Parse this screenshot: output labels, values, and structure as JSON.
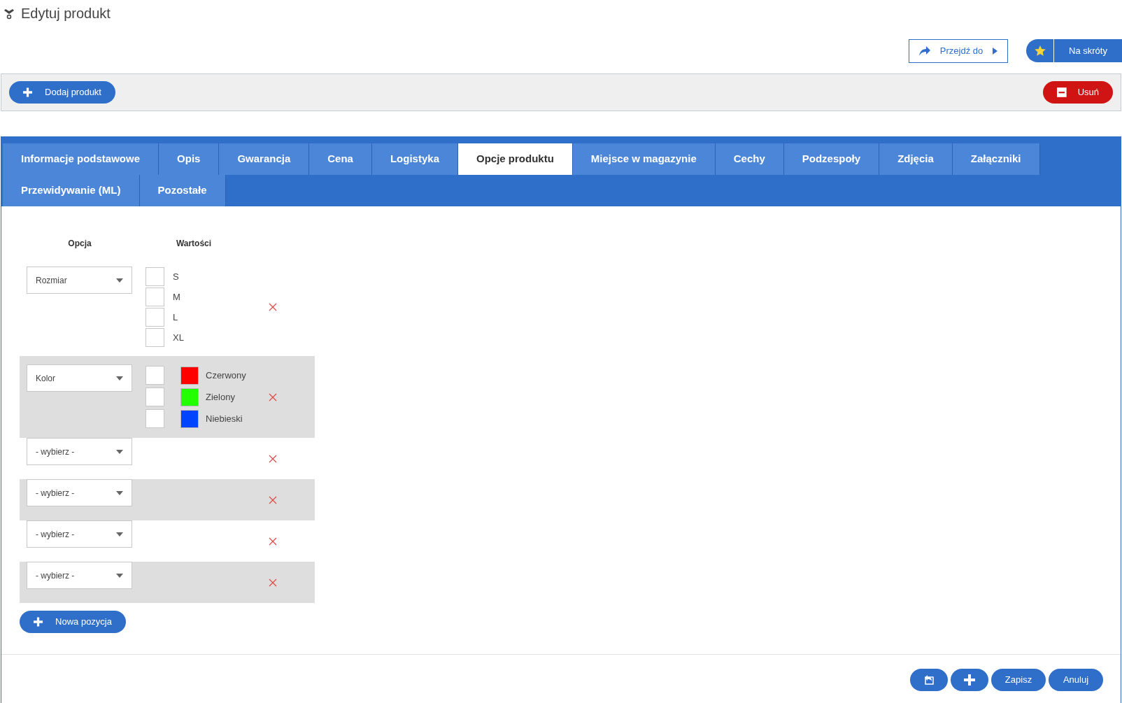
{
  "page_title": "Edytuj produkt",
  "header_buttons": [
    {
      "kind": "goto",
      "label": "Przejdź do"
    },
    {
      "kind": "shortcuts",
      "label": "Na skróty"
    }
  ],
  "toolbar": {
    "add_button": "Dodaj produkt",
    "delete_button": "Usuń"
  },
  "tabs": [
    {
      "label": "Informacje podstawowe",
      "selected": false
    },
    {
      "label": "Opis",
      "selected": false
    },
    {
      "label": "Gwarancja",
      "selected": false
    },
    {
      "label": "Cena",
      "selected": false
    },
    {
      "label": "Logistyka",
      "selected": false
    },
    {
      "label": "Opcje produktu",
      "selected": true
    },
    {
      "label": "Miejsce w magazynie",
      "selected": false
    },
    {
      "label": "Cechy",
      "selected": false
    },
    {
      "label": "Podzespoły",
      "selected": false
    },
    {
      "label": "Zdjęcia",
      "selected": false
    },
    {
      "label": "Załączniki",
      "selected": false
    },
    {
      "label": "Przewidywanie (ML)",
      "selected": false
    },
    {
      "label": "Pozostałe",
      "selected": false
    }
  ],
  "columns": [
    "Opcja",
    "Wartości"
  ],
  "options": [
    {
      "select": "Rozmiar",
      "values": [
        {
          "label": "S",
          "checked": false
        },
        {
          "label": "M",
          "checked": false
        },
        {
          "label": "L",
          "checked": false
        },
        {
          "label": "XL",
          "checked": false
        }
      ]
    },
    {
      "select": "Kolor",
      "values": [
        {
          "label": "Czerwony",
          "checked": false,
          "color": "#ff0000"
        },
        {
          "label": "Zielony",
          "checked": false,
          "color": "#22ff00"
        },
        {
          "label": "Niebieski",
          "checked": false,
          "color": "#0044ff"
        }
      ]
    },
    {
      "select": "- wybierz -"
    },
    {
      "select": "- wybierz -"
    },
    {
      "select": "- wybierz -"
    },
    {
      "select": "- wybierz -"
    }
  ],
  "new_row_button": "Nowa pozycja",
  "footer_buttons": [
    {
      "kind": "back"
    },
    {
      "kind": "add"
    },
    {
      "kind": "text",
      "label": "Zapisz"
    },
    {
      "kind": "text",
      "label": "Anuluj"
    }
  ]
}
